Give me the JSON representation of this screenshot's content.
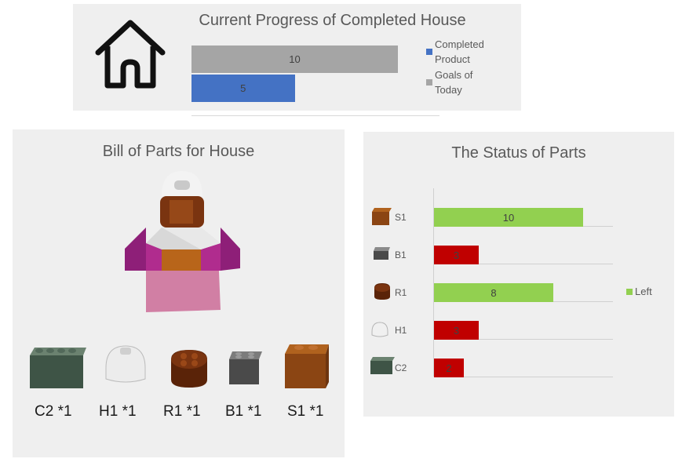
{
  "progress": {
    "title": "Current Progress of Completed House",
    "legend": [
      {
        "label_line1": "Completed",
        "label_line2": "Product",
        "color": "#4472c4"
      },
      {
        "label_line1": "Goals of",
        "label_line2": "Today",
        "color": "#a5a5a5"
      }
    ]
  },
  "bom": {
    "title": "Bill of Parts for House",
    "parts": [
      "C2 *1",
      "H1 *1",
      "R1 *1",
      "B1 *1",
      "S1 *1"
    ]
  },
  "status": {
    "title": "The Status of Parts",
    "legend_label": "Left",
    "legend_color": "#92d050"
  },
  "chart_data": [
    {
      "type": "bar",
      "orientation": "horizontal",
      "title": "Current Progress of Completed House",
      "series": [
        {
          "name": "Goals of Today",
          "values": [
            10
          ],
          "color": "#a5a5a5"
        },
        {
          "name": "Completed Product",
          "values": [
            5
          ],
          "color": "#4472c4"
        }
      ],
      "xlim": [
        0,
        10
      ],
      "legend_position": "right"
    },
    {
      "type": "bar",
      "orientation": "horizontal",
      "title": "The Status of Parts",
      "categories": [
        "S1",
        "B1",
        "R1",
        "H1",
        "C2"
      ],
      "series": [
        {
          "name": "Left",
          "values": [
            10,
            3,
            8,
            3,
            2
          ],
          "colors": [
            "#92d050",
            "#c00000",
            "#92d050",
            "#c00000",
            "#c00000"
          ]
        }
      ],
      "xlim": [
        0,
        12
      ],
      "grid": true,
      "legend_position": "right"
    }
  ]
}
